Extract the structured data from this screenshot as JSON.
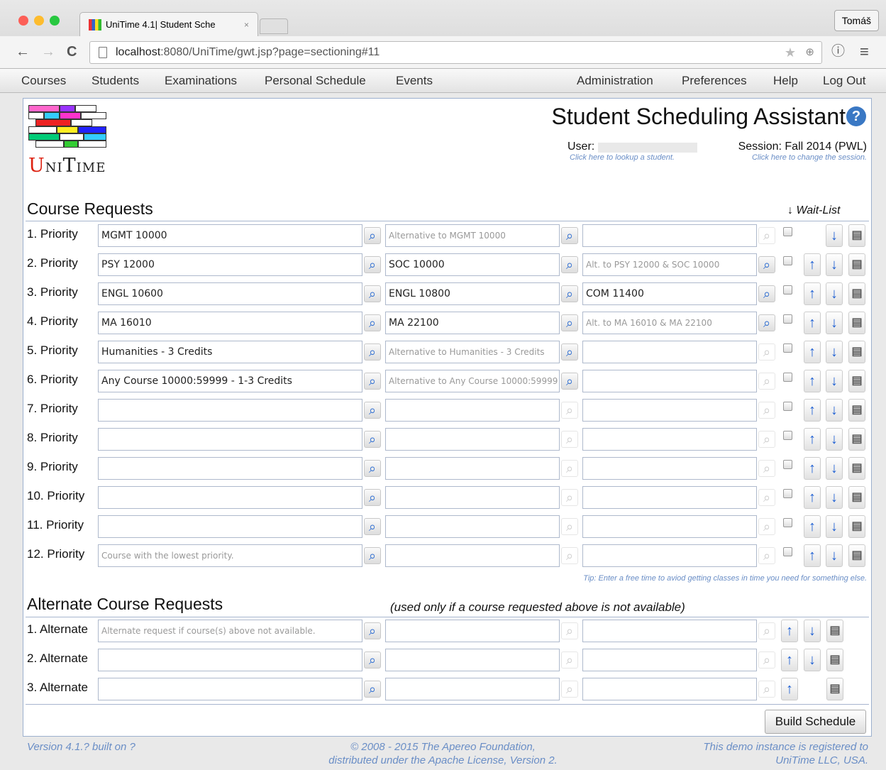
{
  "browser": {
    "tab_title": "UniTime 4.1| Student Sche",
    "tab_close": "×",
    "user": "Tomáš",
    "url_host": "localhost",
    "url_rest": ":8080/UniTime/gwt.jsp?page=sectioning#11",
    "back": "←",
    "forward": "→",
    "reload": "C",
    "info": "ⓘ",
    "menu": "≡"
  },
  "menu": {
    "left": [
      "Courses",
      "Students",
      "Examinations",
      "Personal Schedule",
      "Events"
    ],
    "right": [
      "Administration",
      "Preferences",
      "Help",
      "Log Out"
    ]
  },
  "header": {
    "logo_text_first": "U",
    "logo_text_rest": "NI",
    "logo_text_t": "T",
    "logo_text_end": "IME",
    "title": "Student Scheduling Assistant",
    "help": "?",
    "user_label": "User:",
    "user_hint": "Click here to lookup a student.",
    "session_label": "Session: Fall 2014 (PWL)",
    "session_hint": "Click here to change the session."
  },
  "course_requests": {
    "title": "Course Requests",
    "waitlist_label": "↓ Wait-List",
    "rows": [
      {
        "label": "1. Priority",
        "c1": "MGMT 10000",
        "c2": "Alternative to MGMT 10000",
        "c3": "",
        "c1ph": false,
        "c2ph": true,
        "c3ph": false
      },
      {
        "label": "2. Priority",
        "c1": "PSY 12000",
        "c2": "SOC 10000",
        "c3": "Alt. to PSY 12000 & SOC 10000",
        "c1ph": false,
        "c2ph": false,
        "c3ph": true
      },
      {
        "label": "3. Priority",
        "c1": "ENGL 10600",
        "c2": "ENGL 10800",
        "c3": "COM 11400",
        "c1ph": false,
        "c2ph": false,
        "c3ph": false
      },
      {
        "label": "4. Priority",
        "c1": "MA 16010",
        "c2": "MA 22100",
        "c3": "Alt. to MA 16010 & MA 22100",
        "c1ph": false,
        "c2ph": false,
        "c3ph": true
      },
      {
        "label": "5. Priority",
        "c1": "Humanities - 3 Credits",
        "c2": "Alternative to Humanities - 3 Credits",
        "c3": "",
        "c1ph": false,
        "c2ph": true,
        "c3ph": false
      },
      {
        "label": "6. Priority",
        "c1": "Any Course 10000:59999 - 1-3 Credits",
        "c2": "Alternative to Any Course 10000:59999",
        "c3": "",
        "c1ph": false,
        "c2ph": true,
        "c3ph": false
      },
      {
        "label": "7. Priority",
        "c1": "",
        "c2": "",
        "c3": "",
        "c1ph": false,
        "c2ph": false,
        "c3ph": false
      },
      {
        "label": "8. Priority",
        "c1": "",
        "c2": "",
        "c3": "",
        "c1ph": false,
        "c2ph": false,
        "c3ph": false
      },
      {
        "label": "9. Priority",
        "c1": "",
        "c2": "",
        "c3": "",
        "c1ph": false,
        "c2ph": false,
        "c3ph": false
      },
      {
        "label": "10. Priority",
        "c1": "",
        "c2": "",
        "c3": "",
        "c1ph": false,
        "c2ph": false,
        "c3ph": false
      },
      {
        "label": "11. Priority",
        "c1": "",
        "c2": "",
        "c3": "",
        "c1ph": false,
        "c2ph": false,
        "c3ph": false
      },
      {
        "label": "12. Priority",
        "c1": "Course with the lowest priority.",
        "c2": "",
        "c3": "",
        "c1ph": true,
        "c2ph": false,
        "c3ph": false
      }
    ],
    "tip": "Tip: Enter a free time to aviod getting classes in time you need for something else."
  },
  "alternates": {
    "title": "Alternate Course Requests",
    "note": "(used only if a course requested above is not available)",
    "rows": [
      {
        "label": "1. Alternate",
        "c1": "Alternate request if course(s) above not available.",
        "c1ph": true
      },
      {
        "label": "2. Alternate",
        "c1": "",
        "c1ph": false
      },
      {
        "label": "3. Alternate",
        "c1": "",
        "c1ph": false
      }
    ]
  },
  "build_button": "Build Schedule",
  "footer": {
    "version": "Version 4.1.? built on ?",
    "copyright_1": "© 2008 - 2015 The Apereo Foundation,",
    "copyright_2": "distributed under the Apache License, Version 2.",
    "registered_1": "This demo instance is registered to",
    "registered_2": "UniTime LLC, USA."
  },
  "icons": {
    "search": "search-icon",
    "up": "arrow-up-icon",
    "down": "arrow-down-icon",
    "delete": "trash-icon"
  },
  "colors": {
    "accent": "#1d5fd3",
    "hint": "#6a8ec6",
    "border": "#9cb0ce"
  }
}
